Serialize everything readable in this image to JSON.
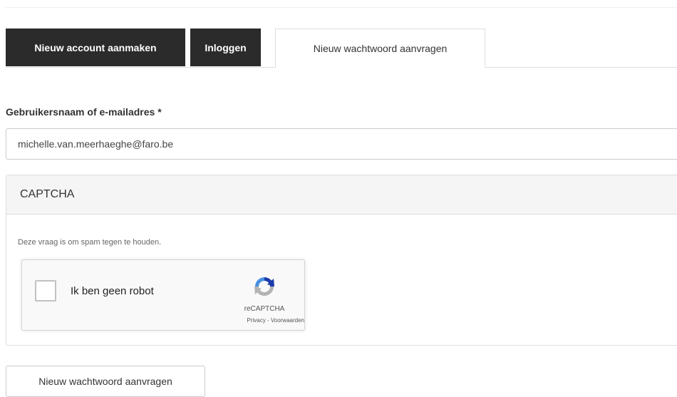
{
  "tabs": [
    {
      "label": "Nieuw account aanmaken",
      "state": "inactive"
    },
    {
      "label": "Inloggen",
      "state": "inactive"
    },
    {
      "label": "Nieuw wachtwoord aanvragen",
      "state": "active"
    }
  ],
  "form": {
    "username_label": "Gebruikersnaam of e-mailadres",
    "required_marker": "*",
    "username_value": "michelle.van.meerhaeghe@faro.be"
  },
  "captcha": {
    "title": "CAPTCHA",
    "description": "Deze vraag is om spam tegen te houden.",
    "checkbox_label": "Ik ben geen robot",
    "checked": false,
    "brand": "reCAPTCHA",
    "privacy_link": "Privacy",
    "separator": " - ",
    "terms_link": "Voorwaarden",
    "logo_icon": "recaptcha-logo-icon"
  },
  "submit": {
    "label": "Nieuw wachtwoord aanvragen"
  },
  "colors": {
    "dark_tab": "#2b2b2b",
    "panel_header": "#f5f5f5",
    "border": "#dddddd",
    "recaptcha_blue": "#4a90e2",
    "recaptcha_dark_blue": "#1c3aa9",
    "recaptcha_gray": "#b3b3b3"
  }
}
